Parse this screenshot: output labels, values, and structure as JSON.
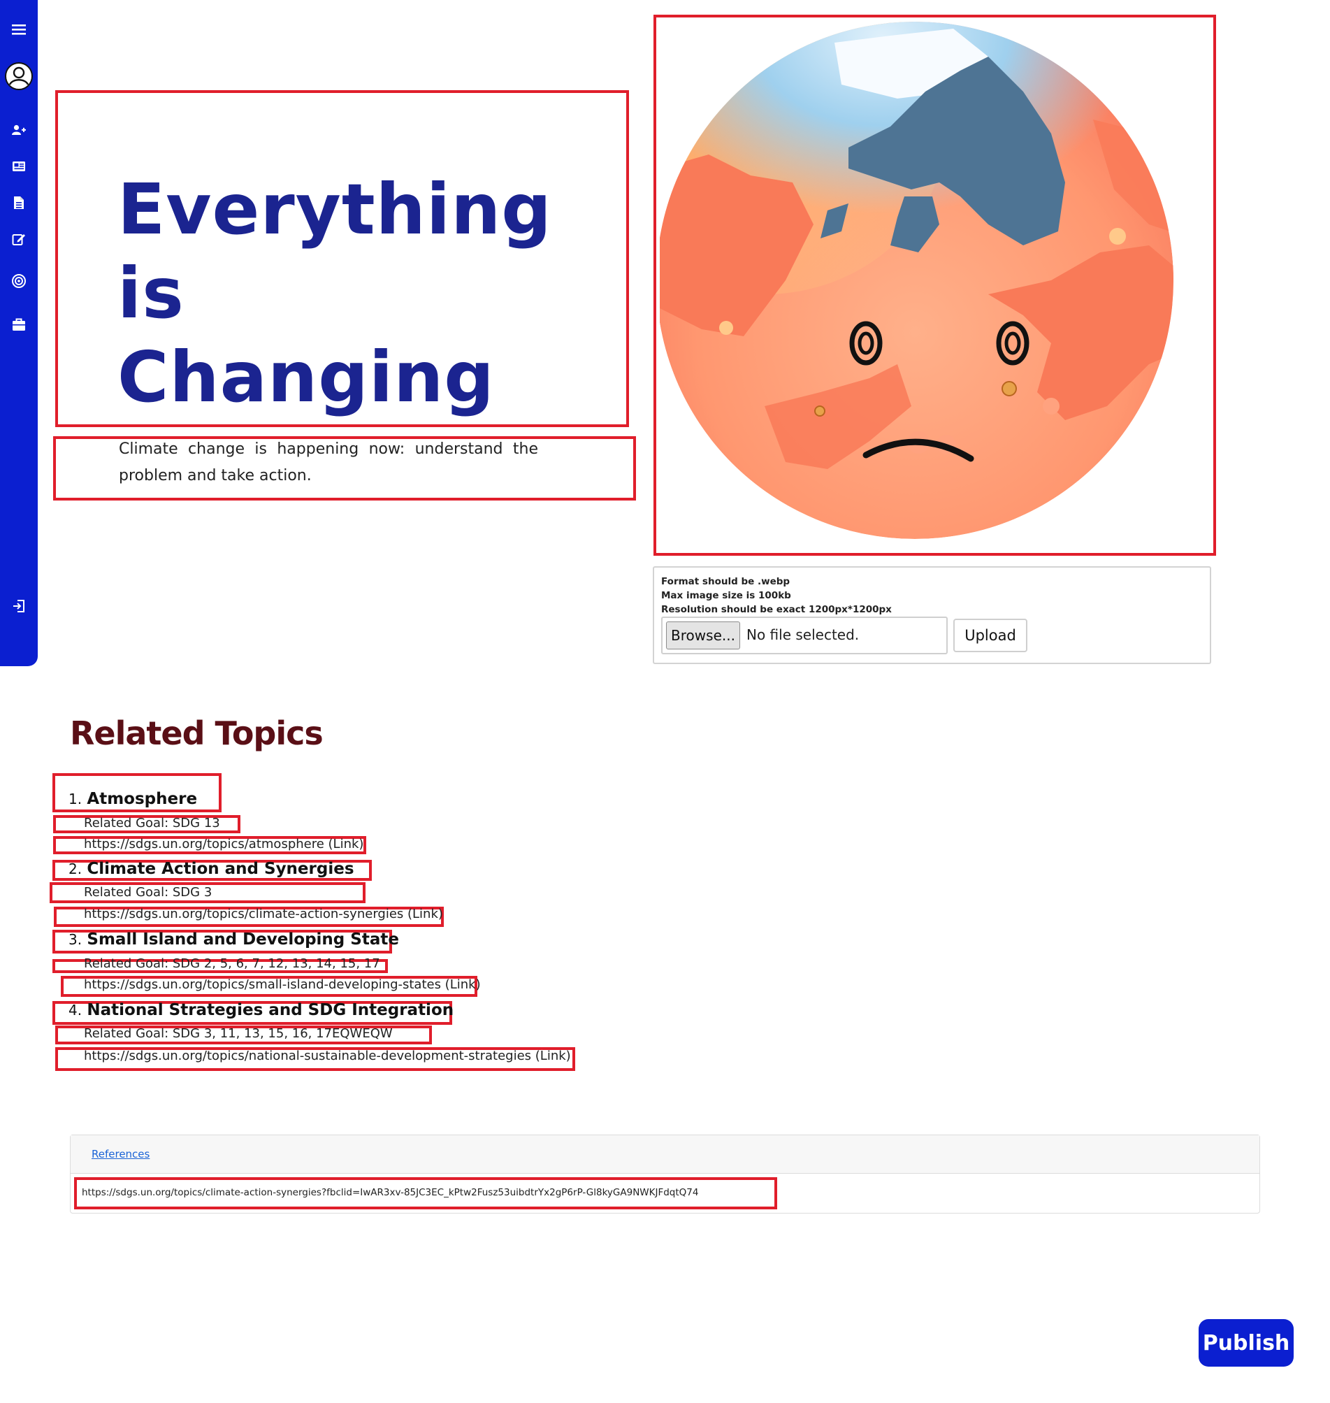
{
  "sidebar": {
    "items": [
      {
        "icon": "menu-icon"
      },
      {
        "icon": "user-avatar-icon"
      },
      {
        "icon": "add-user-icon"
      },
      {
        "icon": "news-icon"
      },
      {
        "icon": "document-icon"
      },
      {
        "icon": "edit-icon"
      },
      {
        "icon": "target-icon"
      },
      {
        "icon": "briefcase-icon"
      },
      {
        "icon": "logout-icon"
      }
    ],
    "color": "#0b1fd0"
  },
  "hero": {
    "title_lines": [
      "Everything",
      "is",
      "Changing"
    ],
    "subtitle": "Climate change is happening now: understand the problem and take action.",
    "title_color": "#1b2490"
  },
  "upload": {
    "requirements": [
      "Format should be .webp",
      "Max image size is 100kb",
      "Resolution should be exact 1200px*1200px"
    ],
    "browse_label": "Browse...",
    "file_status": "No file selected.",
    "upload_label": "Upload"
  },
  "related_topics": {
    "heading": "Related Topics",
    "heading_color": "#5a0f16",
    "items": [
      {
        "number": "1.",
        "title": "Atmosphere",
        "goal": "Related Goal: SDG 13",
        "link": "https://sdgs.un.org/topics/atmosphere (Link)"
      },
      {
        "number": "2.",
        "title": "Climate Action and Synergies",
        "goal": "Related Goal: SDG 3",
        "link": "https://sdgs.un.org/topics/climate-action-synergies (Link)"
      },
      {
        "number": "3.",
        "title": "Small Island and Developing State",
        "goal": "Related Goal: SDG 2, 5, 6, 7, 12, 13, 14, 15, 17",
        "link": "https://sdgs.un.org/topics/small-island-developing-states (Link)"
      },
      {
        "number": "4.",
        "title": "National Strategies and SDG Integration",
        "goal": "Related Goal: SDG 3, 11, 13, 15, 16, 17EQWEQW",
        "link": "https://sdgs.un.org/topics/national-sustainable-development-strategies (Link)"
      }
    ]
  },
  "references": {
    "label": "References",
    "url": "https://sdgs.un.org/topics/climate-action-synergies?fbclid=IwAR3xv-85JC3EC_kPtw2Fusz53uibdtrYx2gP6rP-Gl8kyGA9NWKJFdqtQ74"
  },
  "publish": {
    "label": "Publish",
    "color": "#0b1fd0"
  },
  "highlight_color": "#e01e2b"
}
